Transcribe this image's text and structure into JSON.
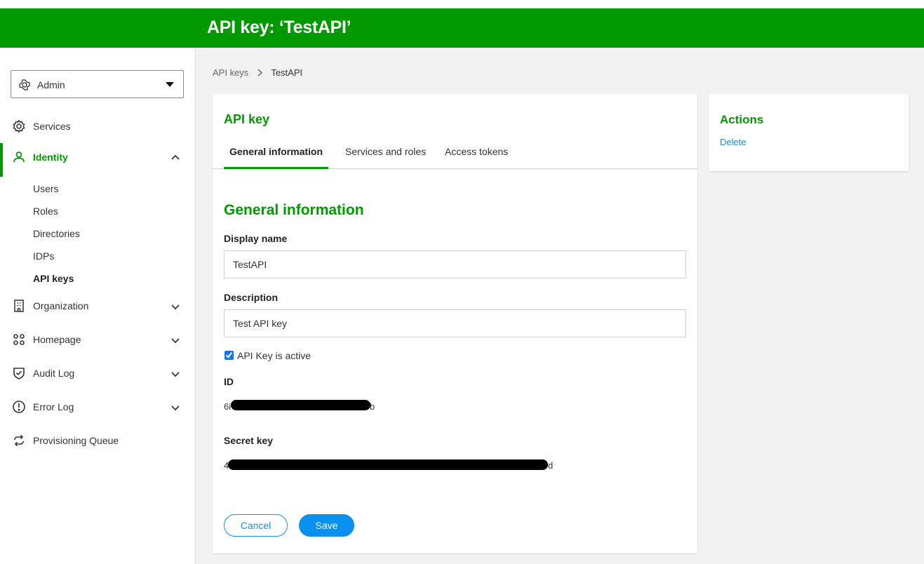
{
  "header": {
    "title": "API key: ‘TestAPI’"
  },
  "sidebar": {
    "tenant": {
      "label": "Admin",
      "icon": "tenant-icon"
    },
    "items": [
      {
        "label": "Services",
        "icon": "gear-icon"
      },
      {
        "label": "Identity",
        "icon": "user-icon",
        "expanded": true
      },
      {
        "label": "Organization",
        "icon": "building-icon"
      },
      {
        "label": "Homepage",
        "icon": "grid-icon"
      },
      {
        "label": "Audit Log",
        "icon": "shield-check-icon"
      },
      {
        "label": "Error Log",
        "icon": "alert-circle-icon"
      },
      {
        "label": "Provisioning Queue",
        "icon": "sync-icon"
      }
    ],
    "identity_subitems": [
      "Users",
      "Roles",
      "Directories",
      "IDPs",
      "API keys"
    ]
  },
  "breadcrumb": {
    "parent": "API keys",
    "current": "TestAPI"
  },
  "card": {
    "title": "API key",
    "tabs": [
      "General information",
      "Services and roles",
      "Access tokens"
    ],
    "section_title": "General information",
    "display_name_label": "Display name",
    "display_name_value": "TestAPI",
    "description_label": "Description",
    "description_value": "Test API key",
    "active_label": "API Key is active",
    "active_checked": true,
    "id_label": "ID",
    "id_start": "6i",
    "id_end": "b",
    "secret_label": "Secret key",
    "secret_start": "4",
    "secret_end": "d",
    "cancel_label": "Cancel",
    "save_label": "Save"
  },
  "actions": {
    "title": "Actions",
    "delete_label": "Delete"
  },
  "colors": {
    "brand_green": "#009a00",
    "link_blue": "#1a8fd8",
    "save_blue": "#0a90ee"
  }
}
